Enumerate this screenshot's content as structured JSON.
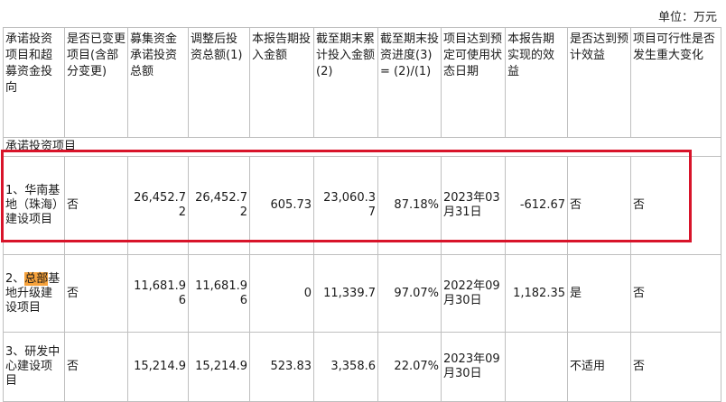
{
  "unit_label": "单位：万元",
  "headers": [
    "承诺投资项目和超募资金投向",
    "是否已变更项目(含部分变更)",
    "募集资金承诺投资总额",
    "调整后投资总额(1)",
    "本报告期投入金额",
    "截至期末累计投入金额(2)",
    "截至期末投资进度(3) = (2)/(1)",
    "项目达到预定可使用状态日期",
    "本报告期实现的效益",
    "是否达到预计效益",
    "项目可行性是否发生重大变化"
  ],
  "section_label": "承诺投资项目",
  "rows": [
    {
      "name": "1、华南基地（珠海）建设项目",
      "changed": "否",
      "committed": "26,452.72",
      "adjusted": "26,452.72",
      "period_input": "605.73",
      "cumulative": "23,060.37",
      "progress": "87.18%",
      "date": "2023年03月31日",
      "benefit": "-612.67",
      "reached": "否",
      "feasibility": "否"
    },
    {
      "name_prefix": "2、",
      "name_highlight": "总部",
      "name_rest": "基地升级建设项目",
      "changed": "否",
      "committed": "11,681.96",
      "adjusted": "11,681.96",
      "period_input": "0",
      "cumulative": "11,339.7",
      "progress": "97.07%",
      "date": "2022年09月30日",
      "benefit": "1,182.35",
      "reached": "是",
      "feasibility": "否"
    },
    {
      "name": "3、研发中心建设项目",
      "changed": "否",
      "committed": "15,214.9",
      "adjusted": "15,214.9",
      "period_input": "523.83",
      "cumulative": "3,358.6",
      "progress": "22.07%",
      "date": "2023年09月30日",
      "benefit": "",
      "reached": "不适用",
      "feasibility": "否"
    }
  ],
  "highlight_color": "#f7a23b",
  "box_color": "#d8142a"
}
